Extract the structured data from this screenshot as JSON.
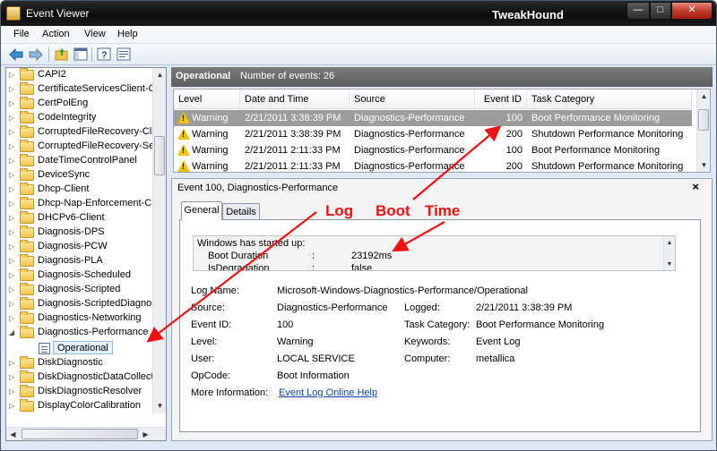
{
  "window": {
    "title": "Event Viewer",
    "brand": "TweakHound",
    "min_glyph": "—",
    "max_glyph": "□",
    "close_glyph": "✕"
  },
  "menu": [
    "File",
    "Action",
    "View",
    "Help"
  ],
  "tree": {
    "items": [
      {
        "label": "CAPI2"
      },
      {
        "label": "CertificateServicesClient-C"
      },
      {
        "label": "CertPolEng"
      },
      {
        "label": "CodeIntegrity"
      },
      {
        "label": "CorruptedFileRecovery-Clie"
      },
      {
        "label": "CorruptedFileRecovery-Serv"
      },
      {
        "label": "DateTimeControlPanel"
      },
      {
        "label": "DeviceSync"
      },
      {
        "label": "Dhcp-Client"
      },
      {
        "label": "Dhcp-Nap-Enforcement-C"
      },
      {
        "label": "DHCPv6-Client"
      },
      {
        "label": "Diagnosis-DPS"
      },
      {
        "label": "Diagnosis-PCW"
      },
      {
        "label": "Diagnosis-PLA"
      },
      {
        "label": "Diagnosis-Scheduled"
      },
      {
        "label": "Diagnosis-Scripted"
      },
      {
        "label": "Diagnosis-ScriptedDiagnos"
      },
      {
        "label": "Diagnostics-Networking"
      },
      {
        "label": "Diagnostics-Performance"
      },
      {
        "label": "Operational"
      },
      {
        "label": "DiskDiagnostic"
      },
      {
        "label": "DiskDiagnosticDataCollecto"
      },
      {
        "label": "DiskDiagnosticResolver"
      },
      {
        "label": "DisplayColorCalibration"
      }
    ]
  },
  "header": {
    "name": "Operational",
    "count": "Number of events: 26"
  },
  "columns": {
    "level": "Level",
    "datetime": "Date and Time",
    "source": "Source",
    "eventid": "Event ID",
    "category": "Task Category"
  },
  "events": [
    {
      "level": "Warning",
      "datetime": "2/21/2011 3:38:39 PM",
      "source": "Diagnostics-Performance",
      "eventid": "100",
      "category": "Boot Performance Monitoring"
    },
    {
      "level": "Warning",
      "datetime": "2/21/2011 3:38:39 PM",
      "source": "Diagnostics-Performance",
      "eventid": "200",
      "category": "Shutdown Performance Monitoring"
    },
    {
      "level": "Warning",
      "datetime": "2/21/2011 2:11:33 PM",
      "source": "Diagnostics-Performance",
      "eventid": "100",
      "category": "Boot Performance Monitoring"
    },
    {
      "level": "Warning",
      "datetime": "2/21/2011 2:11:33 PM",
      "source": "Diagnostics-Performance",
      "eventid": "200",
      "category": "Shutdown Performance Monitoring"
    }
  ],
  "detail": {
    "title": "Event 100, Diagnostics-Performance",
    "close": "×",
    "tab_general": "General",
    "tab_details": "Details",
    "description": {
      "line1": "Windows has started up:",
      "boot_duration_label": "Boot Duration",
      "boot_duration_value": "23192ms",
      "is_degradation_label": "IsDegradation",
      "is_degradation_value": "false",
      "colon": ":"
    },
    "fields": {
      "log_name_label": "Log Name:",
      "log_name": "Microsoft-Windows-Diagnostics-Performance/Operational",
      "source_label": "Source:",
      "source": "Diagnostics-Performance",
      "logged_label": "Logged:",
      "logged": "2/21/2011 3:38:39 PM",
      "event_id_label": "Event ID:",
      "event_id": "100",
      "task_category_label": "Task Category:",
      "task_category": "Boot Performance Monitoring",
      "level_label": "Level:",
      "level": "Warning",
      "keywords_label": "Keywords:",
      "keywords": "Event Log",
      "user_label": "User:",
      "user": "LOCAL SERVICE",
      "computer_label": "Computer:",
      "computer": "metallica",
      "opcode_label": "OpCode:",
      "opcode": "Boot Information",
      "more_info_label": "More Information:",
      "more_info_link": "Event Log Online Help"
    }
  },
  "annotations": {
    "log": "Log",
    "boot": "Boot",
    "time": "Time",
    "color": "#e11111"
  }
}
